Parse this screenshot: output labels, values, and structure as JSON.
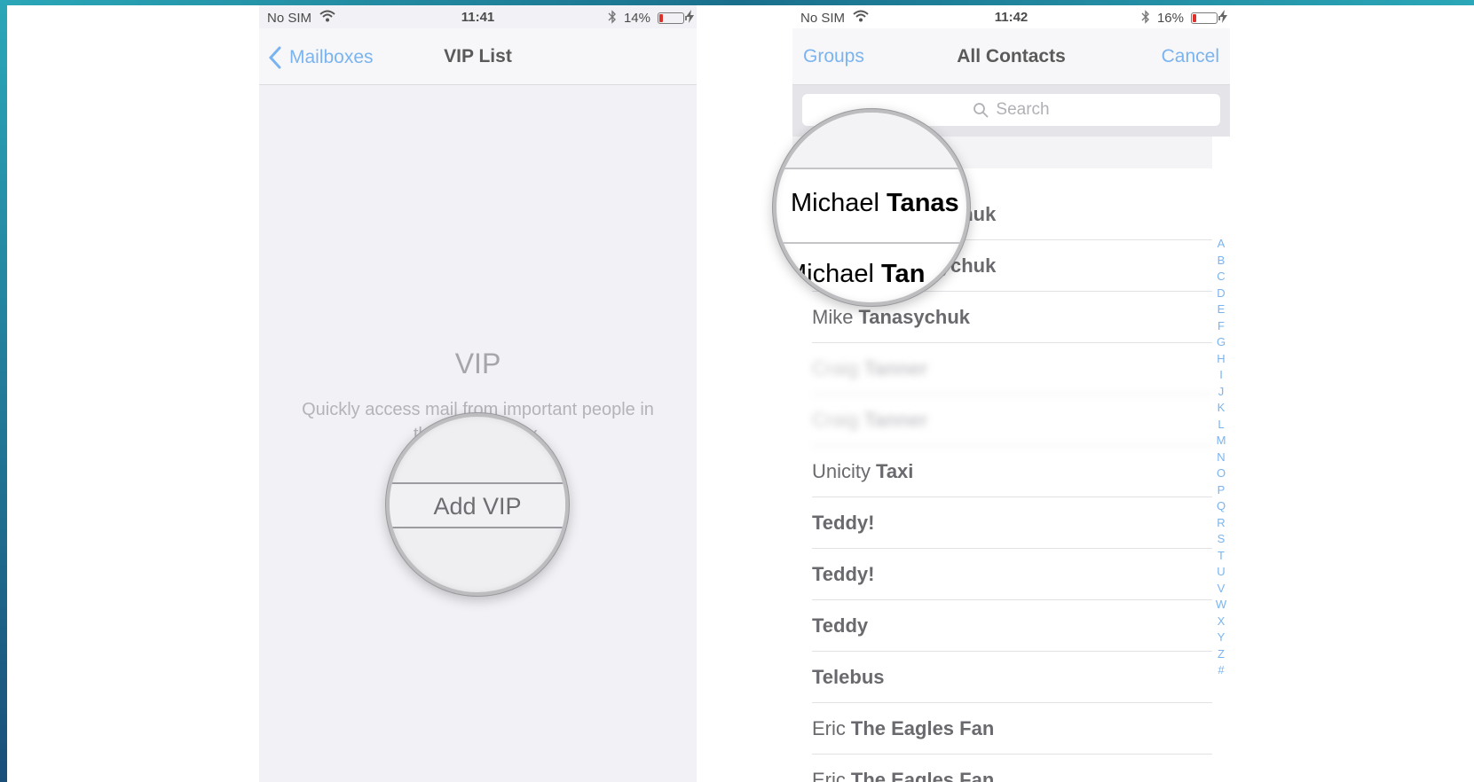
{
  "left": {
    "status": {
      "carrier": "No SIM",
      "time": "11:41",
      "battery": "14%"
    },
    "nav": {
      "back_label": "Mailboxes",
      "title": "VIP List"
    },
    "empty": {
      "heading": "VIP",
      "description": "Quickly access mail from important people in the VIP mailbox."
    },
    "magnifier": {
      "button_label": "Add VIP"
    }
  },
  "right": {
    "status": {
      "carrier": "No SIM",
      "time": "11:42",
      "battery": "16%"
    },
    "nav": {
      "left_label": "Groups",
      "title": "All Contacts",
      "right_label": "Cancel"
    },
    "search": {
      "placeholder": "Search"
    },
    "contacts": [
      {
        "first": "Michael",
        "last": "Tanasychuk",
        "blurred": false
      },
      {
        "first": "Michael",
        "last": "Tanasychuk",
        "blurred": false
      },
      {
        "first": "Mike",
        "last": "Tanasychuk",
        "blurred": false
      },
      {
        "first": "Craig",
        "last": "Tanner",
        "blurred": true
      },
      {
        "first": "Craig",
        "last": "Tanner",
        "blurred": true
      },
      {
        "first": "Unicity",
        "last": "Taxi",
        "blurred": false
      },
      {
        "first": "",
        "last": "Teddy!",
        "blurred": false
      },
      {
        "first": "",
        "last": "Teddy!",
        "blurred": false
      },
      {
        "first": "",
        "last": "Teddy",
        "blurred": false
      },
      {
        "first": "",
        "last": "Telebus",
        "blurred": false
      },
      {
        "first": "Eric",
        "last": "The Eagles Fan",
        "blurred": false
      },
      {
        "first": "Eric",
        "last": "The Eagles Fan",
        "blurred": false
      }
    ],
    "index": [
      "A",
      "B",
      "C",
      "D",
      "E",
      "F",
      "G",
      "H",
      "I",
      "J",
      "K",
      "L",
      "M",
      "N",
      "O",
      "P",
      "Q",
      "R",
      "S",
      "T",
      "U",
      "V",
      "W",
      "X",
      "Y",
      "Z",
      "#"
    ],
    "magnifier": {
      "row1_first": "Michael",
      "row1_last": "Tanas",
      "row2_first": "Michael",
      "row2_last": "Tan"
    }
  },
  "colors": {
    "accent": "#7ab4f0",
    "frame": "#2aa7b8",
    "battery_low": "#e0302a"
  }
}
